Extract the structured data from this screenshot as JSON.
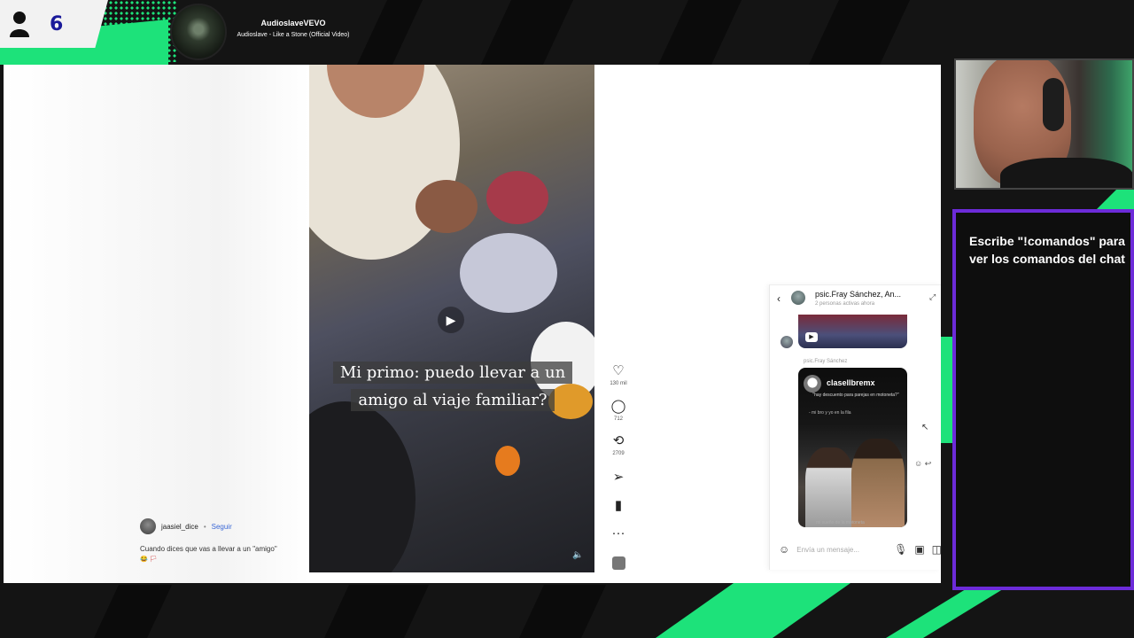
{
  "viewers": {
    "count": "6",
    "icon": "person-icon"
  },
  "now_playing": {
    "artist": "AudioslaveVEVO",
    "title": "Audioslave - Like a Stone (Official Video)"
  },
  "post": {
    "caption_overlay": "Mi primo: puedo llevar a un amigo al viaje familiar?",
    "author": "jaasiel_dice",
    "follow_separator": "•",
    "follow_label": "Seguir",
    "caption": "Cuando dices que vas a llevar a un \"amigo\"",
    "emojis": "😂 🏳"
  },
  "actions": {
    "likes": "130 mil",
    "comments": "712",
    "reposts": "2709"
  },
  "dm": {
    "title": "psic.Fray Sánchez, An...",
    "subtitle": "2 personas activas ahora",
    "sender_label": "psic.Fray Sánchez",
    "shared_account": "clasellbremx",
    "shared_text": "\"hay descuento para parejas en motoneta?\"",
    "shared_subtext": "- mi bro y yo en la fila",
    "shared_bottom": "mi sueño de la motoneta",
    "composer_placeholder": "Envía un mensaje..."
  },
  "commands": {
    "text": "Escribe \"!comandos\" para ver los comandos del chat"
  },
  "colors": {
    "accent_green": "#1de27a",
    "accent_purple": "#6c2bd9",
    "link_blue": "#3a67d6"
  }
}
